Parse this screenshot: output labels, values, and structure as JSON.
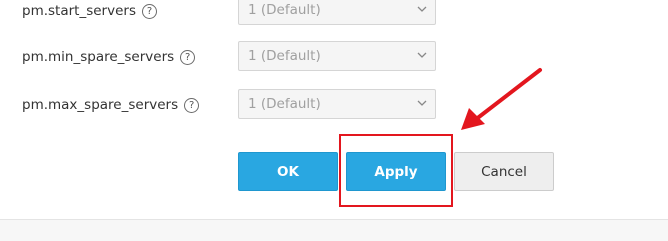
{
  "settings": {
    "rows": [
      {
        "label": "pm.start_servers",
        "value": "1 (Default)"
      },
      {
        "label": "pm.min_spare_servers",
        "value": "1 (Default)"
      },
      {
        "label": "pm.max_spare_servers",
        "value": "1 (Default)"
      }
    ],
    "help_glyph": "?"
  },
  "buttons": {
    "ok_label": "OK",
    "apply_label": "Apply",
    "cancel_label": "Cancel"
  },
  "annotation": {
    "color": "#e3161e",
    "target": "apply-button"
  },
  "colors": {
    "primary": "#29a7e1",
    "secondary": "#eeeeee"
  }
}
